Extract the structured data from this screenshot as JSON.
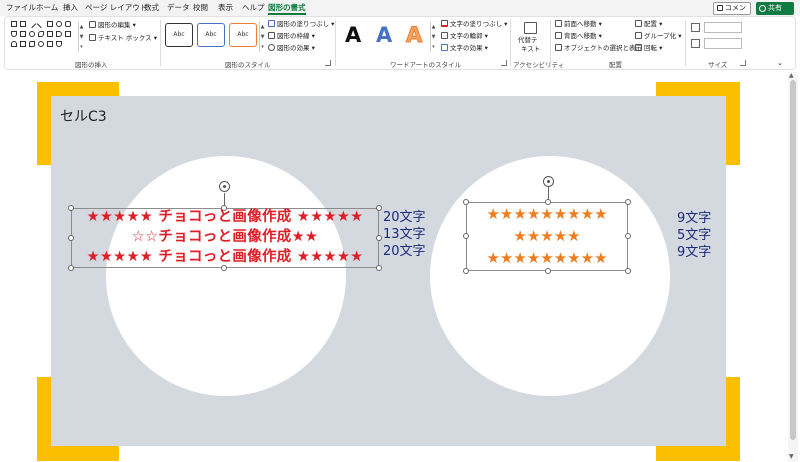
{
  "tabs": [
    "ファイル",
    "ホーム",
    "挿入",
    "ページ レイアウト",
    "数式",
    "データ",
    "校閲",
    "表示",
    "ヘルプ",
    "図形の書式"
  ],
  "active_tab": "図形の書式",
  "buttons": {
    "comment": "コメント",
    "share": "共有"
  },
  "ribbon": {
    "insert_shapes": {
      "label": "図形の挿入",
      "edit_shape": "図形の編集",
      "text_box": "テキスト ボックス"
    },
    "shape_styles": {
      "label": "図形のスタイル",
      "sample": [
        "Abc",
        "Abc",
        "Abc"
      ],
      "fill": "図形の塗りつぶし",
      "outline": "図形の枠線",
      "effects": "図形の効果"
    },
    "wordart_styles": {
      "label": "ワードアートのスタイル",
      "letters": [
        "A",
        "A",
        "A"
      ],
      "text_fill": "文字の塗りつぶし",
      "text_outline": "文字の輪郭",
      "text_effects": "文字の効果"
    },
    "accessibility": {
      "label": "アクセシビリティ",
      "alt_text_1": "代替テ",
      "alt_text_2": "キスト"
    },
    "arrange": {
      "label": "配置",
      "bring_forward": "前面へ移動",
      "send_backward": "背面へ移動",
      "selection_pane": "オブジェクトの選択と表示",
      "align": "配置",
      "group": "グループ化",
      "rotate": "回転"
    },
    "size": {
      "label": "サイズ"
    }
  },
  "sheet": {
    "cell_label": "セルC3",
    "left_text": [
      "★★★★★ チョコっと画像作成 ★★★★★",
      "☆☆チョコっと画像作成★★",
      "★★★★★ チョコっと画像作成 ★★★★★"
    ],
    "left_counts": [
      "20文字",
      "13文字",
      "20文字"
    ],
    "right_text": [
      "★★★★★★★★★",
      "★★★★★",
      "★★★★★★★★★"
    ],
    "right_counts": [
      "9文字",
      "5文字",
      "9文字"
    ]
  },
  "colors": {
    "accent": "#107c41",
    "corner": "#fbbf00",
    "canvas": "#d4d8df",
    "red_text": "#e01e27",
    "orange_star": "#ee7d1f",
    "count_text": "#1a2a7c"
  }
}
